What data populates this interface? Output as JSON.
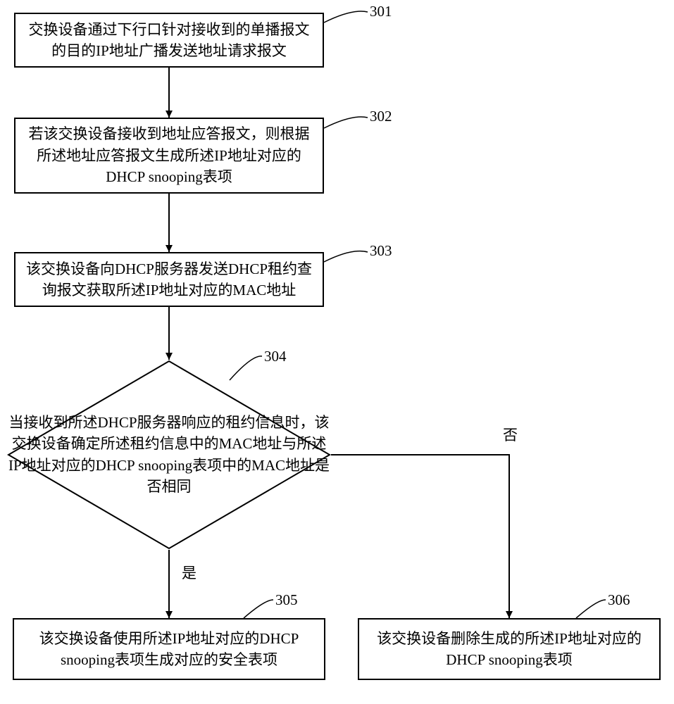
{
  "steps": {
    "s301": {
      "num": "301",
      "text": "交换设备通过下行口针对接收到的单播报文的目的IP地址广播发送地址请求报文"
    },
    "s302": {
      "num": "302",
      "text": "若该交换设备接收到地址应答报文，则根据所述地址应答报文生成所述IP地址对应的DHCP snooping表项"
    },
    "s303": {
      "num": "303",
      "text": "该交换设备向DHCP服务器发送DHCP租约查询报文获取所述IP地址对应的MAC地址"
    },
    "s304": {
      "num": "304",
      "text": "当接收到所述DHCP服务器响应的租约信息时，该交换设备确定所述租约信息中的MAC地址与所述IP地址对应的DHCP snooping表项中的MAC地址是否相同"
    },
    "s305": {
      "num": "305",
      "text": "该交换设备使用所述IP地址对应的DHCP snooping表项生成对应的安全表项"
    },
    "s306": {
      "num": "306",
      "text": "该交换设备删除生成的所述IP地址对应的DHCP snooping表项"
    }
  },
  "branches": {
    "yes": "是",
    "no": "否"
  }
}
